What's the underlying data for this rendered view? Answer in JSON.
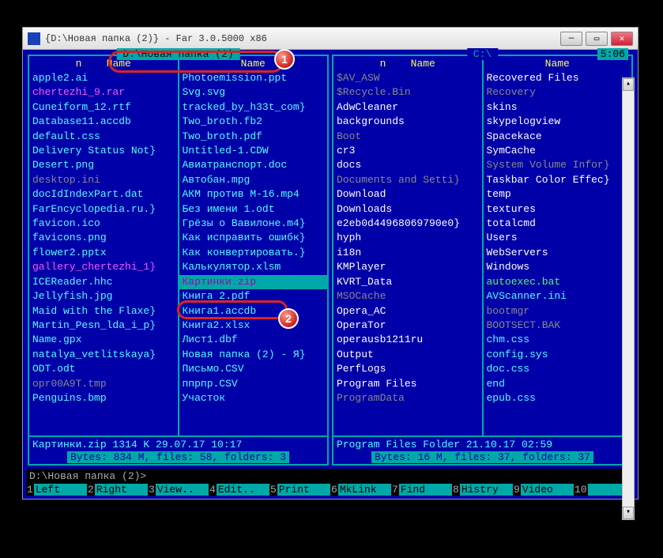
{
  "window": {
    "title": "{D:\\Новая папка (2)} - Far 3.0.5000 x86"
  },
  "time": "5:06",
  "leftPanel": {
    "path": " D:\\Новая папка (2) ",
    "headers": {
      "n": "n",
      "name1": "Name",
      "name2": "Name"
    },
    "col1": [
      {
        "t": "apple2.ai",
        "c": ""
      },
      {
        "t": "chertezhi_9.rar",
        "c": "magenta"
      },
      {
        "t": "Cuneiform_12.rtf",
        "c": ""
      },
      {
        "t": "Database11.accdb",
        "c": ""
      },
      {
        "t": "default.css",
        "c": ""
      },
      {
        "t": "Delivery Status Not}",
        "c": ""
      },
      {
        "t": "Desert.png",
        "c": ""
      },
      {
        "t": "desktop.ini",
        "c": "gray"
      },
      {
        "t": "docIdIndexPart.dat",
        "c": ""
      },
      {
        "t": "FarEncyclopedia.ru.}",
        "c": ""
      },
      {
        "t": "favicon.ico",
        "c": ""
      },
      {
        "t": "favicons.png",
        "c": ""
      },
      {
        "t": "flower2.pptx",
        "c": ""
      },
      {
        "t": "gallery_chertezhi_1}",
        "c": "magenta"
      },
      {
        "t": "ICEReader.hhc",
        "c": ""
      },
      {
        "t": "Jellyfish.jpg",
        "c": ""
      },
      {
        "t": "Maid with the Flaxe}",
        "c": ""
      },
      {
        "t": "Martin_Pesn_lda_i_p}",
        "c": ""
      },
      {
        "t": "Name.gpx",
        "c": ""
      },
      {
        "t": "natalya_vetlitskaya}",
        "c": ""
      },
      {
        "t": "ODT.odt",
        "c": ""
      },
      {
        "t": "opr00A9T.tmp",
        "c": "gray"
      },
      {
        "t": "Penguins.bmp",
        "c": ""
      }
    ],
    "col2": [
      {
        "t": "Photoemission.ppt",
        "c": ""
      },
      {
        "t": "Svg.svg",
        "c": ""
      },
      {
        "t": "tracked_by_h33t_com}",
        "c": ""
      },
      {
        "t": "Two_broth.fb2",
        "c": ""
      },
      {
        "t": "Two_broth.pdf",
        "c": ""
      },
      {
        "t": "Untitled-1.CDW",
        "c": ""
      },
      {
        "t": "Авиатранспорт.doc",
        "c": ""
      },
      {
        "t": "Автобан.mpg",
        "c": ""
      },
      {
        "t": "АКМ против М-16.mp4",
        "c": ""
      },
      {
        "t": "Без имени 1.odt",
        "c": ""
      },
      {
        "t": "Грёзы о Вавилоне.m4}",
        "c": ""
      },
      {
        "t": "Как исправить ошибк}",
        "c": ""
      },
      {
        "t": "Как конвертировать.}",
        "c": ""
      },
      {
        "t": "Калькулятор.xlsm",
        "c": ""
      },
      {
        "t": "Картинки.zip",
        "c": "magenta selected"
      },
      {
        "t": "Книга 2.pdf",
        "c": ""
      },
      {
        "t": "Книга1.accdb",
        "c": ""
      },
      {
        "t": "Книга2.xlsx",
        "c": ""
      },
      {
        "t": "Лист1.dbf",
        "c": ""
      },
      {
        "t": "Новая папка (2) - Я}",
        "c": ""
      },
      {
        "t": "Письмо.CSV",
        "c": ""
      },
      {
        "t": "ппрпр.CSV",
        "c": ""
      },
      {
        "t": "Участок",
        "c": ""
      }
    ],
    "status": "Картинки.zip      1314 K 29.07.17 10:17",
    "summary": " Bytes: 834 M, files: 58, folders: 3 "
  },
  "rightPanel": {
    "path": " C:\\ ",
    "headers": {
      "n": "n",
      "name1": "Name",
      "name2": "Name"
    },
    "col1": [
      {
        "t": "$AV_ASW",
        "c": "gray"
      },
      {
        "t": "$Recycle.Bin",
        "c": "gray"
      },
      {
        "t": "AdwCleaner",
        "c": "white"
      },
      {
        "t": "backgrounds",
        "c": "white"
      },
      {
        "t": "Boot",
        "c": "gray"
      },
      {
        "t": "cr3",
        "c": "white"
      },
      {
        "t": "docs",
        "c": "white"
      },
      {
        "t": "Documents and Setti}",
        "c": "gray"
      },
      {
        "t": "Download",
        "c": "white"
      },
      {
        "t": "Downloads",
        "c": "white"
      },
      {
        "t": "e2eb0d44968069790e0}",
        "c": "white"
      },
      {
        "t": "hyph",
        "c": "white"
      },
      {
        "t": "i18n",
        "c": "white"
      },
      {
        "t": "KMPlayer",
        "c": "white"
      },
      {
        "t": "KVRT_Data",
        "c": "white"
      },
      {
        "t": "MSOCache",
        "c": "gray"
      },
      {
        "t": "Opera_AC",
        "c": "white"
      },
      {
        "t": "OperaTor",
        "c": "white"
      },
      {
        "t": "operausb1211ru",
        "c": "white"
      },
      {
        "t": "Output",
        "c": "white"
      },
      {
        "t": "PerfLogs",
        "c": "white"
      },
      {
        "t": "Program Files",
        "c": "white"
      },
      {
        "t": "ProgramData",
        "c": "gray"
      }
    ],
    "col2": [
      {
        "t": "Recovered Files",
        "c": "white"
      },
      {
        "t": "Recovery",
        "c": "gray"
      },
      {
        "t": "skins",
        "c": "white"
      },
      {
        "t": "skypelogview",
        "c": "white"
      },
      {
        "t": "Spacekace",
        "c": "white"
      },
      {
        "t": "SymCache",
        "c": "white"
      },
      {
        "t": "System Volume Infor}",
        "c": "gray"
      },
      {
        "t": "Taskbar Color Effec}",
        "c": "white"
      },
      {
        "t": "temp",
        "c": "white"
      },
      {
        "t": "textures",
        "c": "white"
      },
      {
        "t": "totalcmd",
        "c": "white"
      },
      {
        "t": "Users",
        "c": "white"
      },
      {
        "t": "WebServers",
        "c": "white"
      },
      {
        "t": "Windows",
        "c": "white"
      },
      {
        "t": "autoexec.bat",
        "c": "green"
      },
      {
        "t": "AVScanner.ini",
        "c": ""
      },
      {
        "t": "bootmgr",
        "c": "gray"
      },
      {
        "t": "BOOTSECT.BAK",
        "c": "gray"
      },
      {
        "t": "chm.css",
        "c": ""
      },
      {
        "t": "config.sys",
        "c": ""
      },
      {
        "t": "doc.css",
        "c": ""
      },
      {
        "t": "end",
        "c": ""
      },
      {
        "t": "epub.css",
        "c": ""
      }
    ],
    "status": "Program Files     Folder 21.10.17 02:59",
    "summary": " Bytes: 16 M, files: 37, folders: 37 "
  },
  "prompt": "D:\\Новая папка (2)>",
  "fkeys": [
    {
      "n": "1",
      "l": "Left"
    },
    {
      "n": "2",
      "l": "Right"
    },
    {
      "n": "3",
      "l": "View.."
    },
    {
      "n": "4",
      "l": "Edit.."
    },
    {
      "n": "5",
      "l": "Print"
    },
    {
      "n": "6",
      "l": "MkLink"
    },
    {
      "n": "7",
      "l": "Find"
    },
    {
      "n": "8",
      "l": "Histry"
    },
    {
      "n": "9",
      "l": "Video"
    },
    {
      "n": "10",
      "l": ""
    }
  ],
  "annotations": {
    "b1": "1",
    "b2": "2"
  }
}
